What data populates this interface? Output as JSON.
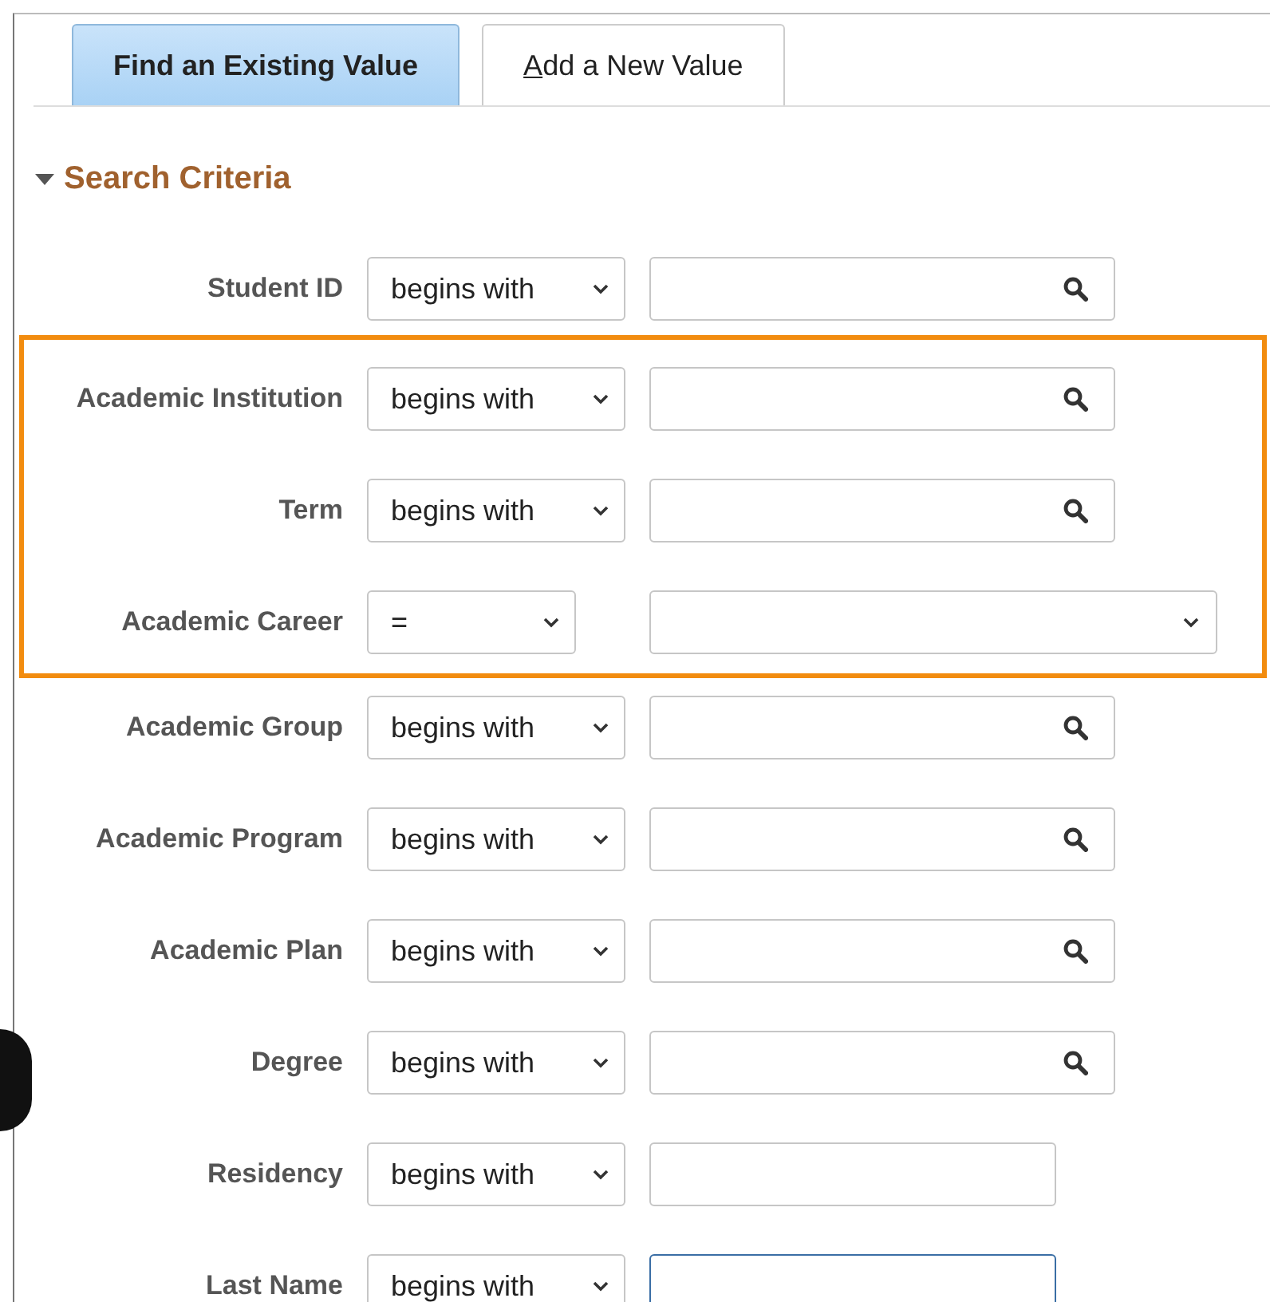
{
  "tabs": [
    {
      "label": "Find an Existing Value",
      "selected": true,
      "access_key_underlined": false
    },
    {
      "label": "Add a New Value",
      "selected": false,
      "access_key_underlined": true
    }
  ],
  "section": {
    "title": "Search Criteria",
    "expanded": true
  },
  "criteria": [
    {
      "label": "Student ID",
      "operator": "begins with",
      "kind": "lookup",
      "highlighted": false,
      "focused": false
    },
    {
      "label": "Academic Institution",
      "operator": "begins with",
      "kind": "lookup",
      "highlighted": true,
      "focused": false
    },
    {
      "label": "Term",
      "operator": "begins with",
      "kind": "lookup",
      "highlighted": true,
      "focused": false
    },
    {
      "label": "Academic Career",
      "operator": "=",
      "kind": "dropdown",
      "highlighted": true,
      "focused": false
    },
    {
      "label": "Academic Group",
      "operator": "begins with",
      "kind": "lookup",
      "highlighted": false,
      "focused": false
    },
    {
      "label": "Academic Program",
      "operator": "begins with",
      "kind": "lookup",
      "highlighted": false,
      "focused": false
    },
    {
      "label": "Academic Plan",
      "operator": "begins with",
      "kind": "lookup",
      "highlighted": false,
      "focused": false
    },
    {
      "label": "Degree",
      "operator": "begins with",
      "kind": "lookup",
      "highlighted": false,
      "focused": false
    },
    {
      "label": "Residency",
      "operator": "begins with",
      "kind": "text",
      "highlighted": false,
      "focused": false
    },
    {
      "label": "Last Name",
      "operator": "begins with",
      "kind": "text",
      "highlighted": false,
      "focused": true
    }
  ]
}
